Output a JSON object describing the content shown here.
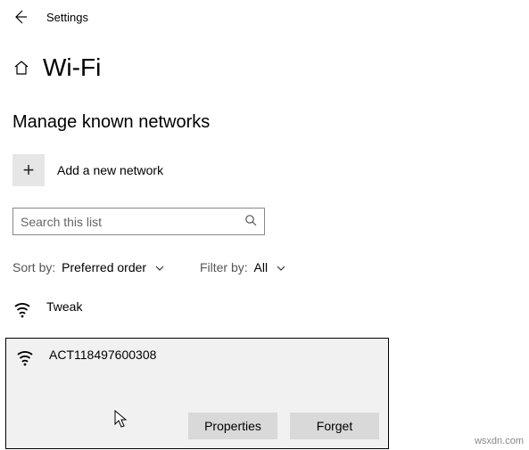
{
  "titlebar": {
    "title": "Settings"
  },
  "header": {
    "title": "Wi-Fi"
  },
  "subheader": "Manage known networks",
  "add_network": {
    "label": "Add a new network",
    "plus": "+"
  },
  "search": {
    "placeholder": "Search this list"
  },
  "filters": {
    "sort_label": "Sort by:",
    "sort_value": "Preferred order",
    "filter_label": "Filter by:",
    "filter_value": "All"
  },
  "networks": {
    "item0": {
      "name": "Tweak"
    },
    "selected": {
      "name": "ACT118497600308",
      "btn_properties": "Properties",
      "btn_forget": "Forget"
    }
  },
  "watermark": "wsxdn.com"
}
